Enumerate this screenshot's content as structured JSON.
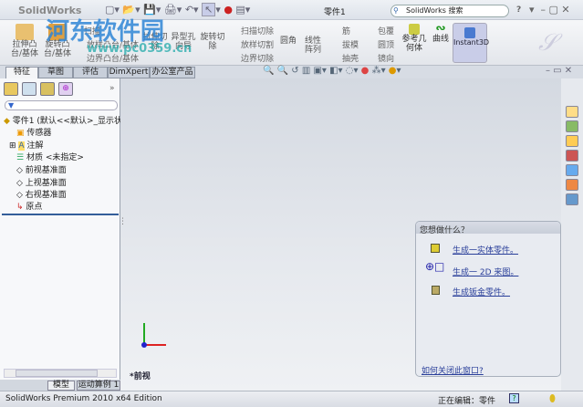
{
  "title": {
    "app": "SolidWorks",
    "doc": "零件1",
    "search_placeholder": "SolidWorks 搜索",
    "help": "?"
  },
  "watermark": {
    "name": "河东软件园",
    "url": "www.pc0359.cn"
  },
  "ribbon": {
    "extrude_boss": "拉伸凸台/基体",
    "revolve_boss": "旋转凸台/基体",
    "sweep": "扫描",
    "loft_boss": "放样凸台/基体",
    "boundary_boss": "边界凸台/基体",
    "extrude_cut": "拉伸切除",
    "hole_wizard": "异型孔向导",
    "revolve_cut": "旋转切除",
    "sweep_cut": "扫描切除",
    "loft_cut": "放样切割",
    "boundary_cut": "边界切除",
    "fillet": "圆角",
    "linear_pattern": "线性阵列",
    "rib": "筋",
    "draft": "拔模",
    "shell": "抽壳",
    "wrap": "包覆",
    "dome": "圆顶",
    "mirror": "镜向",
    "ref_geometry": "参考几何体",
    "curves": "曲线",
    "instant3d": "Instant3D"
  },
  "tabs": [
    "特征",
    "草图",
    "评估",
    "DimXpert",
    "办公室产品"
  ],
  "tree": {
    "root": "零件1 (默认<<默认>_显示状态",
    "items": [
      "传感器",
      "注解",
      "材质 <未指定>",
      "前视基准面",
      "上视基准面",
      "右视基准面",
      "原点"
    ]
  },
  "viewport": {
    "view_label": "*前视"
  },
  "task": {
    "title": "您想做什么？",
    "items": [
      "生成一实体零件。",
      "生成一 2D 来图。",
      "生成钣金零件。"
    ],
    "close_link": "如何关闭此窗口?"
  },
  "bottom_tabs": [
    "模型",
    "运动算例 1"
  ],
  "status": {
    "edition": "SolidWorks Premium 2010 x64 Edition",
    "editing": "正在编辑：零件"
  }
}
